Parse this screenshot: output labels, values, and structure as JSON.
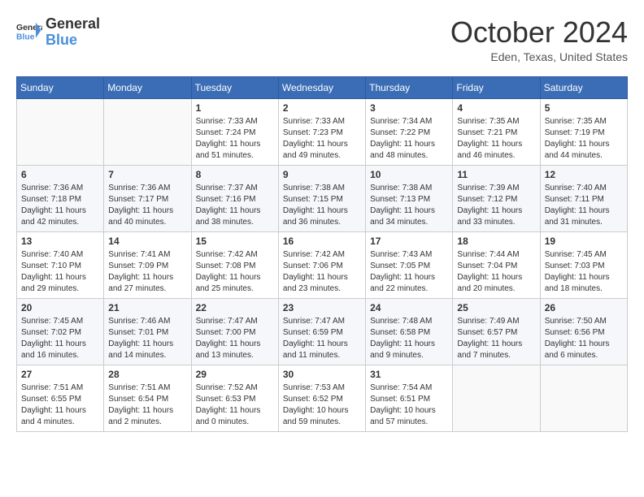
{
  "logo": {
    "text1": "General",
    "text2": "Blue"
  },
  "title": "October 2024",
  "location": "Eden, Texas, United States",
  "days_header": [
    "Sunday",
    "Monday",
    "Tuesday",
    "Wednesday",
    "Thursday",
    "Friday",
    "Saturday"
  ],
  "weeks": [
    [
      {
        "day": "",
        "sunrise": "",
        "sunset": "",
        "daylight": ""
      },
      {
        "day": "",
        "sunrise": "",
        "sunset": "",
        "daylight": ""
      },
      {
        "day": "1",
        "sunrise": "Sunrise: 7:33 AM",
        "sunset": "Sunset: 7:24 PM",
        "daylight": "Daylight: 11 hours and 51 minutes."
      },
      {
        "day": "2",
        "sunrise": "Sunrise: 7:33 AM",
        "sunset": "Sunset: 7:23 PM",
        "daylight": "Daylight: 11 hours and 49 minutes."
      },
      {
        "day": "3",
        "sunrise": "Sunrise: 7:34 AM",
        "sunset": "Sunset: 7:22 PM",
        "daylight": "Daylight: 11 hours and 48 minutes."
      },
      {
        "day": "4",
        "sunrise": "Sunrise: 7:35 AM",
        "sunset": "Sunset: 7:21 PM",
        "daylight": "Daylight: 11 hours and 46 minutes."
      },
      {
        "day": "5",
        "sunrise": "Sunrise: 7:35 AM",
        "sunset": "Sunset: 7:19 PM",
        "daylight": "Daylight: 11 hours and 44 minutes."
      }
    ],
    [
      {
        "day": "6",
        "sunrise": "Sunrise: 7:36 AM",
        "sunset": "Sunset: 7:18 PM",
        "daylight": "Daylight: 11 hours and 42 minutes."
      },
      {
        "day": "7",
        "sunrise": "Sunrise: 7:36 AM",
        "sunset": "Sunset: 7:17 PM",
        "daylight": "Daylight: 11 hours and 40 minutes."
      },
      {
        "day": "8",
        "sunrise": "Sunrise: 7:37 AM",
        "sunset": "Sunset: 7:16 PM",
        "daylight": "Daylight: 11 hours and 38 minutes."
      },
      {
        "day": "9",
        "sunrise": "Sunrise: 7:38 AM",
        "sunset": "Sunset: 7:15 PM",
        "daylight": "Daylight: 11 hours and 36 minutes."
      },
      {
        "day": "10",
        "sunrise": "Sunrise: 7:38 AM",
        "sunset": "Sunset: 7:13 PM",
        "daylight": "Daylight: 11 hours and 34 minutes."
      },
      {
        "day": "11",
        "sunrise": "Sunrise: 7:39 AM",
        "sunset": "Sunset: 7:12 PM",
        "daylight": "Daylight: 11 hours and 33 minutes."
      },
      {
        "day": "12",
        "sunrise": "Sunrise: 7:40 AM",
        "sunset": "Sunset: 7:11 PM",
        "daylight": "Daylight: 11 hours and 31 minutes."
      }
    ],
    [
      {
        "day": "13",
        "sunrise": "Sunrise: 7:40 AM",
        "sunset": "Sunset: 7:10 PM",
        "daylight": "Daylight: 11 hours and 29 minutes."
      },
      {
        "day": "14",
        "sunrise": "Sunrise: 7:41 AM",
        "sunset": "Sunset: 7:09 PM",
        "daylight": "Daylight: 11 hours and 27 minutes."
      },
      {
        "day": "15",
        "sunrise": "Sunrise: 7:42 AM",
        "sunset": "Sunset: 7:08 PM",
        "daylight": "Daylight: 11 hours and 25 minutes."
      },
      {
        "day": "16",
        "sunrise": "Sunrise: 7:42 AM",
        "sunset": "Sunset: 7:06 PM",
        "daylight": "Daylight: 11 hours and 23 minutes."
      },
      {
        "day": "17",
        "sunrise": "Sunrise: 7:43 AM",
        "sunset": "Sunset: 7:05 PM",
        "daylight": "Daylight: 11 hours and 22 minutes."
      },
      {
        "day": "18",
        "sunrise": "Sunrise: 7:44 AM",
        "sunset": "Sunset: 7:04 PM",
        "daylight": "Daylight: 11 hours and 20 minutes."
      },
      {
        "day": "19",
        "sunrise": "Sunrise: 7:45 AM",
        "sunset": "Sunset: 7:03 PM",
        "daylight": "Daylight: 11 hours and 18 minutes."
      }
    ],
    [
      {
        "day": "20",
        "sunrise": "Sunrise: 7:45 AM",
        "sunset": "Sunset: 7:02 PM",
        "daylight": "Daylight: 11 hours and 16 minutes."
      },
      {
        "day": "21",
        "sunrise": "Sunrise: 7:46 AM",
        "sunset": "Sunset: 7:01 PM",
        "daylight": "Daylight: 11 hours and 14 minutes."
      },
      {
        "day": "22",
        "sunrise": "Sunrise: 7:47 AM",
        "sunset": "Sunset: 7:00 PM",
        "daylight": "Daylight: 11 hours and 13 minutes."
      },
      {
        "day": "23",
        "sunrise": "Sunrise: 7:47 AM",
        "sunset": "Sunset: 6:59 PM",
        "daylight": "Daylight: 11 hours and 11 minutes."
      },
      {
        "day": "24",
        "sunrise": "Sunrise: 7:48 AM",
        "sunset": "Sunset: 6:58 PM",
        "daylight": "Daylight: 11 hours and 9 minutes."
      },
      {
        "day": "25",
        "sunrise": "Sunrise: 7:49 AM",
        "sunset": "Sunset: 6:57 PM",
        "daylight": "Daylight: 11 hours and 7 minutes."
      },
      {
        "day": "26",
        "sunrise": "Sunrise: 7:50 AM",
        "sunset": "Sunset: 6:56 PM",
        "daylight": "Daylight: 11 hours and 6 minutes."
      }
    ],
    [
      {
        "day": "27",
        "sunrise": "Sunrise: 7:51 AM",
        "sunset": "Sunset: 6:55 PM",
        "daylight": "Daylight: 11 hours and 4 minutes."
      },
      {
        "day": "28",
        "sunrise": "Sunrise: 7:51 AM",
        "sunset": "Sunset: 6:54 PM",
        "daylight": "Daylight: 11 hours and 2 minutes."
      },
      {
        "day": "29",
        "sunrise": "Sunrise: 7:52 AM",
        "sunset": "Sunset: 6:53 PM",
        "daylight": "Daylight: 11 hours and 0 minutes."
      },
      {
        "day": "30",
        "sunrise": "Sunrise: 7:53 AM",
        "sunset": "Sunset: 6:52 PM",
        "daylight": "Daylight: 10 hours and 59 minutes."
      },
      {
        "day": "31",
        "sunrise": "Sunrise: 7:54 AM",
        "sunset": "Sunset: 6:51 PM",
        "daylight": "Daylight: 10 hours and 57 minutes."
      },
      {
        "day": "",
        "sunrise": "",
        "sunset": "",
        "daylight": ""
      },
      {
        "day": "",
        "sunrise": "",
        "sunset": "",
        "daylight": ""
      }
    ]
  ]
}
